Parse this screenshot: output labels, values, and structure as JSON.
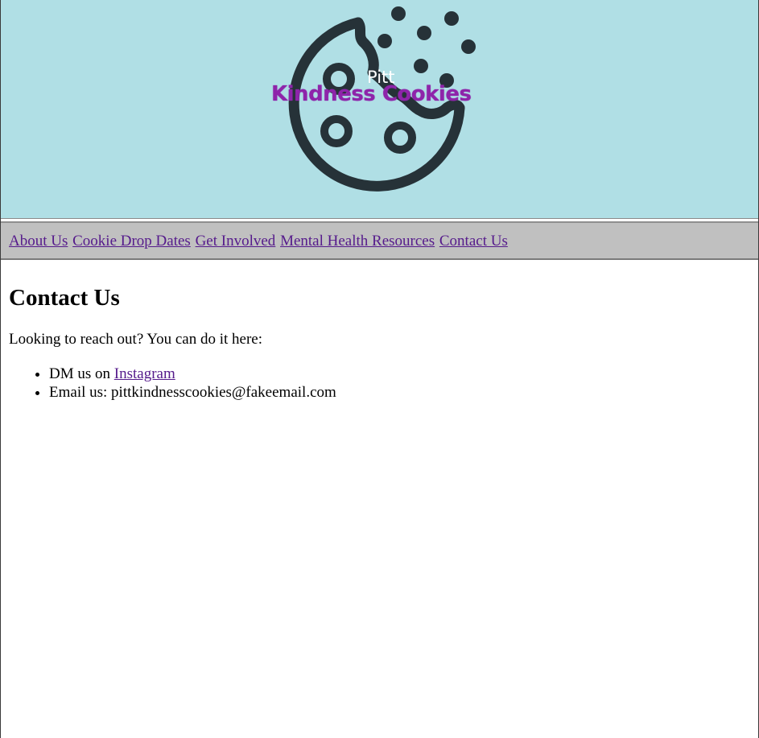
{
  "logo": {
    "small_text": "Pitt",
    "main_text": "Kindness Cookies"
  },
  "nav": {
    "items": [
      {
        "label": "About Us"
      },
      {
        "label": "Cookie Drop Dates"
      },
      {
        "label": "Get Involved"
      },
      {
        "label": "Mental Health Resources"
      },
      {
        "label": "Contact Us"
      }
    ]
  },
  "main": {
    "title": "Contact Us",
    "intro": "Looking to reach out? You can do it here:",
    "list": [
      {
        "prefix": "DM us on ",
        "link": "Instagram"
      },
      {
        "text": "Email us: pittkindnesscookies@fakeemail.com"
      }
    ]
  },
  "colors": {
    "banner_bg": "#b0dfe5",
    "nav_bg": "#c0c0c0",
    "link": "#551a8b",
    "logo_text": "#8e24aa",
    "cookie_outline": "#263238"
  }
}
